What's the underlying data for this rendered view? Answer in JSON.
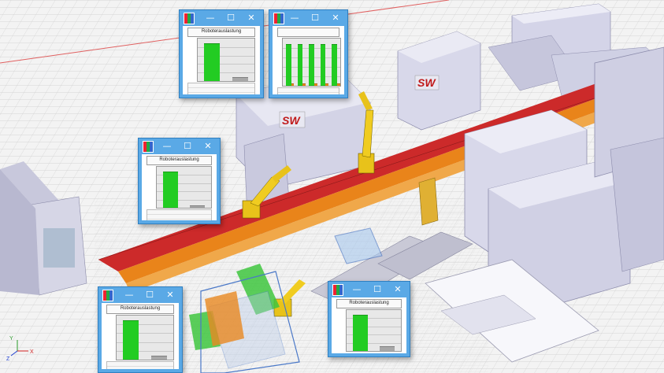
{
  "window_controls": {
    "minimize": "—",
    "maximize": "☐",
    "close": "✕"
  },
  "windows": [
    {
      "id": "win-1",
      "title_icon": "chart-app-icon",
      "chart_data": {
        "type": "bar",
        "title": "Roboterauslastung",
        "categories": [
          "1",
          "2"
        ],
        "series": [
          {
            "values": [
              100,
              8
            ]
          }
        ],
        "ylim": [
          0,
          110
        ],
        "colors": [
          "#22cc22",
          "#a8a8a8"
        ],
        "grid": true
      }
    },
    {
      "id": "win-2",
      "title_icon": "chart-app-icon",
      "chart_data": {
        "type": "bar",
        "title": "",
        "categories": [
          "1",
          "2",
          "3",
          "4",
          "5"
        ],
        "series": [
          {
            "values": [
              90,
              90,
              90,
              90,
              90
            ]
          },
          {
            "values": [
              3,
              3,
              3,
              3,
              3
            ]
          }
        ],
        "ylim": [
          0,
          100
        ],
        "colors": [
          "#22cc22",
          "#e8881a"
        ],
        "grid": true
      }
    },
    {
      "id": "win-3",
      "title_icon": "chart-app-icon",
      "chart_data": {
        "type": "bar",
        "title": "Roboterauslastung",
        "categories": [
          "1",
          "2"
        ],
        "series": [
          {
            "values": [
              100,
              4
            ]
          }
        ],
        "ylim": [
          0,
          110
        ],
        "colors": [
          "#22cc22",
          "#a8a8a8"
        ],
        "grid": true
      }
    },
    {
      "id": "win-4",
      "title_icon": "chart-app-icon",
      "chart_data": {
        "type": "bar",
        "title": "Roboterauslastung",
        "categories": [
          "1",
          "2"
        ],
        "series": [
          {
            "values": [
              100,
              8
            ]
          }
        ],
        "ylim": [
          0,
          110
        ],
        "colors": [
          "#22cc22",
          "#a8a8a8"
        ],
        "grid": true
      }
    },
    {
      "id": "win-5",
      "title_icon": "chart-app-icon",
      "chart_data": {
        "type": "bar",
        "title": "Roboterauslastung",
        "categories": [
          "1",
          "2"
        ],
        "series": [
          {
            "values": [
              100,
              12
            ]
          }
        ],
        "ylim": [
          0,
          110
        ],
        "colors": [
          "#22cc22",
          "#a8a8a8"
        ],
        "grid": true
      }
    }
  ],
  "scene": {
    "signage_text": "SW",
    "axis_labels": {
      "x": "X",
      "y": "Y",
      "z": "Z"
    },
    "colors": {
      "floor": "#f2f2f2",
      "grid": "#c9c9c9",
      "machine": "#d8d8ea",
      "machine_dark": "#9c9cb8",
      "robot": "#e8c21a",
      "conveyor_red": "#cc2a2a",
      "conveyor_orange": "#e9841a",
      "green_panel": "#3ec53e",
      "steel_blue": "#4a78c8"
    }
  }
}
